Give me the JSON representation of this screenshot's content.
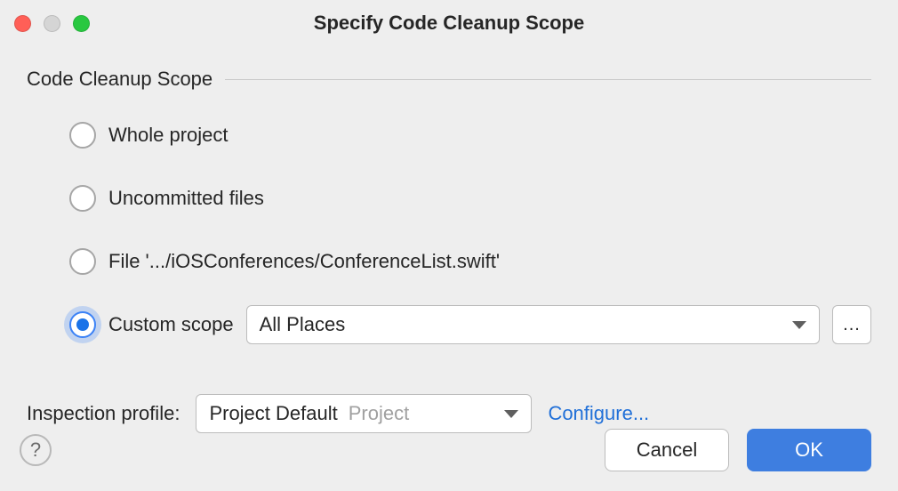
{
  "window": {
    "title": "Specify Code Cleanup Scope"
  },
  "group": {
    "title": "Code Cleanup Scope"
  },
  "radios": {
    "whole_project": "Whole project",
    "uncommitted": "Uncommitted files",
    "file": "File '.../iOSConferences/ConferenceList.swift'",
    "custom_scope": "Custom scope"
  },
  "scope_combo": {
    "value": "All Places"
  },
  "ellipsis": "...",
  "profile": {
    "label": "Inspection profile:",
    "value": "Project Default",
    "hint": "Project",
    "configure": "Configure..."
  },
  "footer": {
    "help": "?",
    "cancel": "Cancel",
    "ok": "OK"
  }
}
